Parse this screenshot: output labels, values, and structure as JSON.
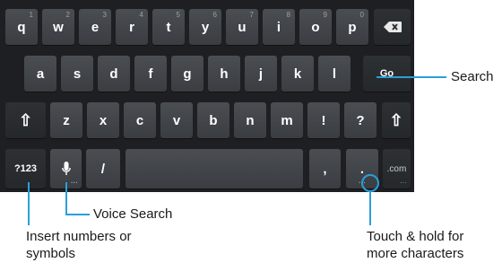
{
  "keyboard": {
    "row1": [
      {
        "label": "q",
        "hint": "1"
      },
      {
        "label": "w",
        "hint": "2"
      },
      {
        "label": "e",
        "hint": "3"
      },
      {
        "label": "r",
        "hint": "4"
      },
      {
        "label": "t",
        "hint": "5"
      },
      {
        "label": "y",
        "hint": "6"
      },
      {
        "label": "u",
        "hint": "7"
      },
      {
        "label": "i",
        "hint": "8"
      },
      {
        "label": "o",
        "hint": "9"
      },
      {
        "label": "p",
        "hint": "0"
      }
    ],
    "row2": [
      {
        "label": "a"
      },
      {
        "label": "s"
      },
      {
        "label": "d"
      },
      {
        "label": "f"
      },
      {
        "label": "g"
      },
      {
        "label": "h"
      },
      {
        "label": "j"
      },
      {
        "label": "k"
      },
      {
        "label": "l"
      }
    ],
    "row3": [
      {
        "label": "z"
      },
      {
        "label": "x"
      },
      {
        "label": "c"
      },
      {
        "label": "v"
      },
      {
        "label": "b"
      },
      {
        "label": "n"
      },
      {
        "label": "m"
      },
      {
        "label": "!"
      },
      {
        "label": "?"
      }
    ],
    "backspace_icon": "backspace-icon",
    "go_label": "Go",
    "shift_icon": "⇧",
    "numbers_label": "?123",
    "mic_icon": "microphone-icon",
    "slash_label": "/",
    "comma_label": ",",
    "period_label": ".",
    "dotcom_label": ".com"
  },
  "annotations": {
    "search": "Search",
    "voice_search": "Voice Search",
    "insert_numbers_line1": "Insert numbers or",
    "insert_numbers_line2": "symbols",
    "touch_hold_line1": "Touch & hold for",
    "touch_hold_line2": "more characters"
  },
  "colors": {
    "accent": "#2a9fd8",
    "keyboard_bg": "#1d1f22"
  }
}
